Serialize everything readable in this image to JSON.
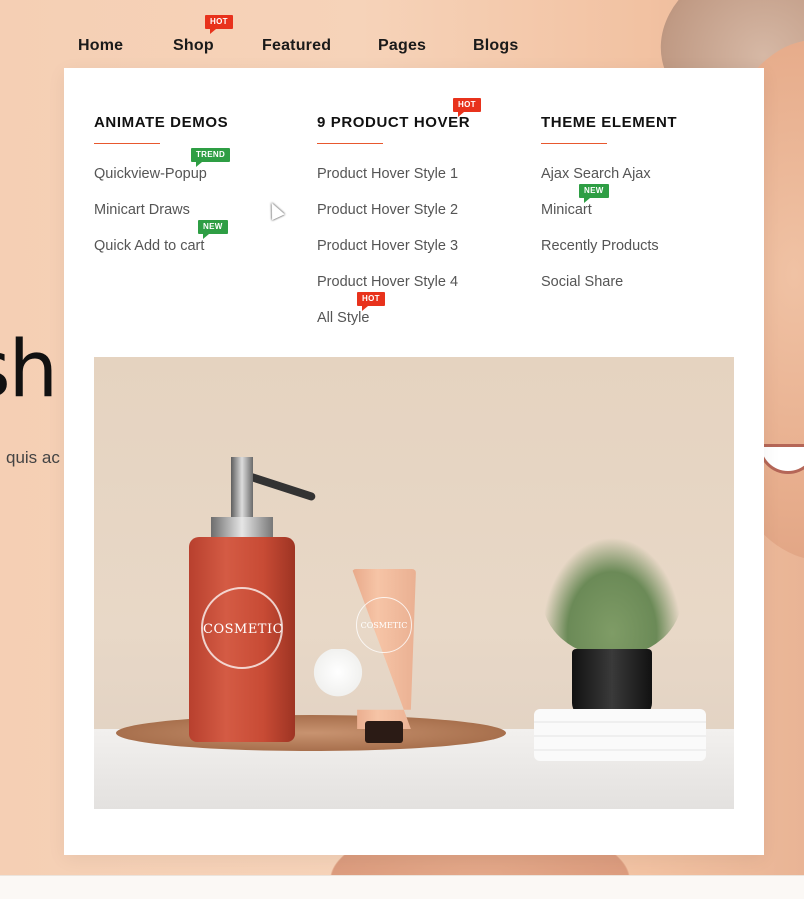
{
  "nav": {
    "items": [
      {
        "label": "Home"
      },
      {
        "label": "Shop",
        "badge": "HOT"
      },
      {
        "label": "Featured"
      },
      {
        "label": "Pages"
      },
      {
        "label": "Blogs"
      }
    ]
  },
  "hero": {
    "title_fragment": "sh",
    "subtitle_fragment": "quis ac"
  },
  "mega_menu": {
    "columns": [
      {
        "title": "ANIMATE DEMOS",
        "items": [
          {
            "label": "Quickview-Popup",
            "badge": "TREND"
          },
          {
            "label": "Minicart Draws"
          },
          {
            "label": "Quick Add to cart",
            "badge": "NEW"
          }
        ]
      },
      {
        "title": "9 PRODUCT HOVER",
        "title_badge": "HOT",
        "items": [
          {
            "label": "Product Hover Style 1"
          },
          {
            "label": "Product Hover Style 2"
          },
          {
            "label": "Product Hover Style 3"
          },
          {
            "label": "Product Hover Style 4"
          },
          {
            "label": "All Style",
            "badge": "HOT"
          }
        ]
      },
      {
        "title": "THEME ELEMENT",
        "items": [
          {
            "label": "Ajax Search Ajax"
          },
          {
            "label": "Minicart",
            "badge": "NEW"
          },
          {
            "label": "Recently Products"
          },
          {
            "label": "Social Share"
          }
        ]
      }
    ],
    "promo": {
      "bottle_text": "COSMETIC",
      "tube_text": "COSMETIC"
    }
  },
  "colors": {
    "accent": "#e8582e",
    "hot_badge": "#e8321c",
    "new_badge": "#2e9e44",
    "hero_bg": "#f5cfb4"
  }
}
